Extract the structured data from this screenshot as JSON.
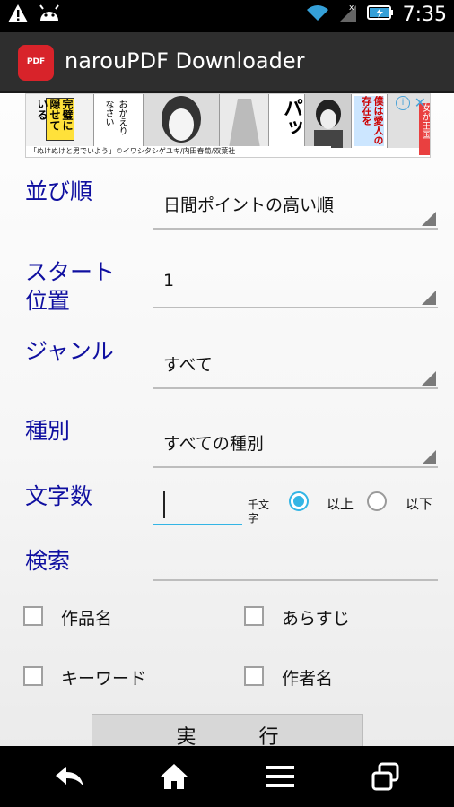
{
  "status_bar": {
    "time": "7:35",
    "icons": [
      "warning-icon",
      "android-icon",
      "wifi-icon",
      "signal-icon",
      "battery-charging-icon"
    ]
  },
  "app": {
    "title": "narouPDF Downloader",
    "logo_text": "PDF"
  },
  "ad": {
    "caption": "「ぬけぬけと男でいよう」©イワシタシゲユキ/内田春菊/双葉社",
    "close_symbol": "✕",
    "info_symbol": "i",
    "texts": [
      "完璧に隠せている",
      "おかえりなさい",
      "パッ",
      "僕は愛人の存在を",
      "女が王国"
    ]
  },
  "form": {
    "sort": {
      "label": "並び順",
      "value": "日間ポイントの高い順"
    },
    "start": {
      "label_line1": "スタート",
      "label_line2": "位置",
      "value": "1"
    },
    "genre": {
      "label": "ジャンル",
      "value": "すべて"
    },
    "type": {
      "label": "種別",
      "value": "すべての種別"
    },
    "char_count": {
      "label": "文字数",
      "unit_line1": "千文",
      "unit_line2": "字",
      "value": "",
      "options": [
        {
          "label": "以上",
          "selected": true
        },
        {
          "label": "以下",
          "selected": false
        }
      ]
    },
    "search": {
      "label": "検索",
      "value": ""
    },
    "checkboxes": [
      {
        "label": "作品名",
        "checked": false
      },
      {
        "label": "あらすじ",
        "checked": false
      },
      {
        "label": "キーワード",
        "checked": false
      },
      {
        "label": "作者名",
        "checked": false
      }
    ],
    "execute_label": "実行"
  },
  "nav": [
    "back-icon",
    "home-icon",
    "menu-icon",
    "recent-apps-icon"
  ],
  "colors": {
    "label_blue": "#0f0fa0",
    "accent": "#33b5e5",
    "app_red": "#d8232a"
  }
}
